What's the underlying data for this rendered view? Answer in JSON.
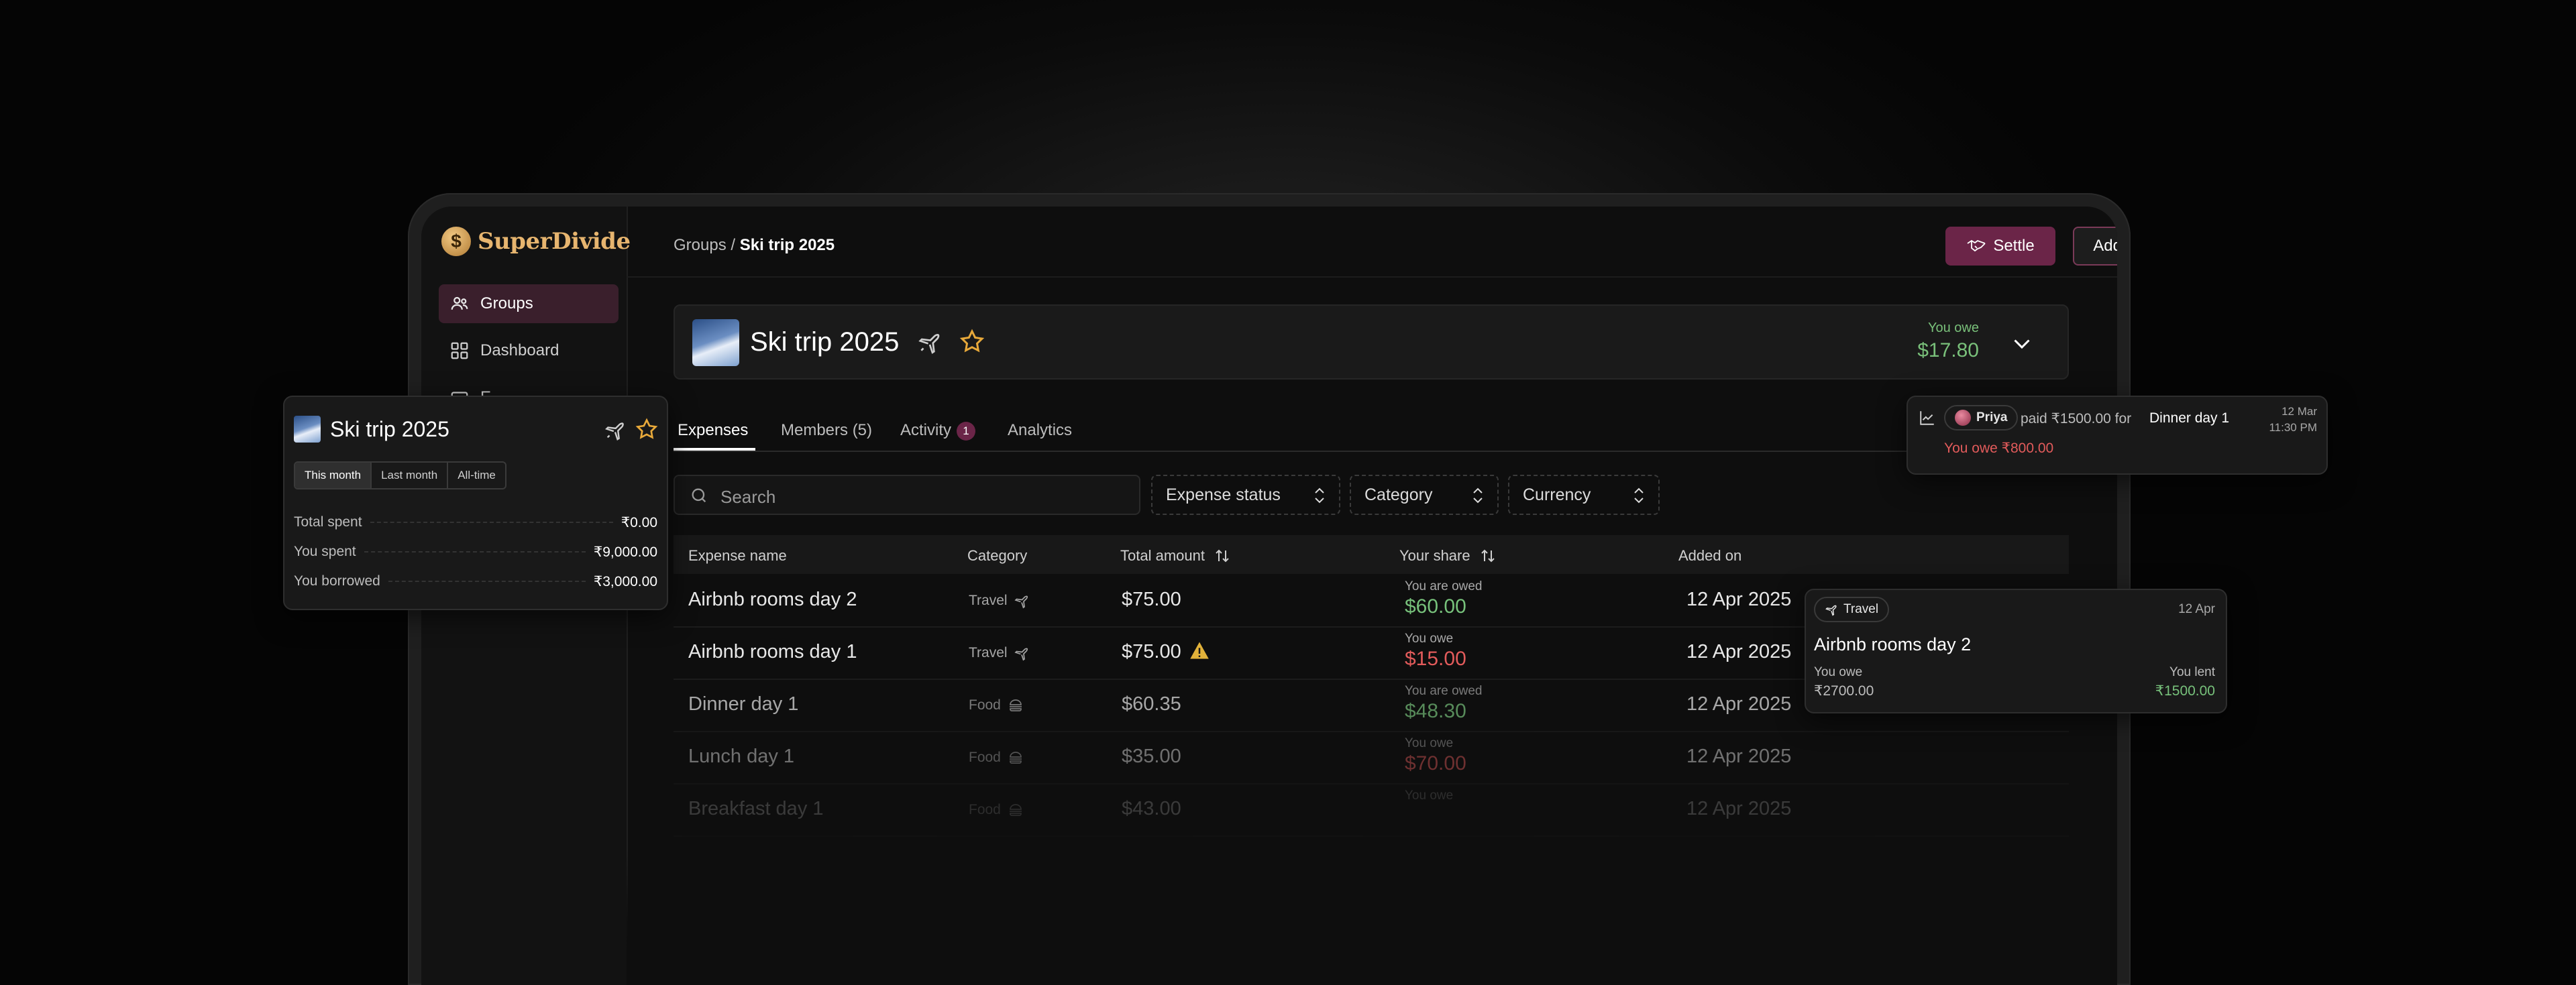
{
  "app": {
    "brand": "SuperDivide",
    "sidebar": [
      {
        "label": "Groups",
        "icon": "users-icon",
        "active": true
      },
      {
        "label": "Dashboard",
        "icon": "dashboard-icon",
        "active": false
      },
      {
        "label": "E",
        "icon": "wallet-icon",
        "active": false
      }
    ]
  },
  "header": {
    "breadcrumb_root": "Groups",
    "breadcrumb_sep": "/",
    "breadcrumb_current": "Ski trip 2025",
    "settle_label": "Settle",
    "add_expense_label": "Add an expense"
  },
  "group": {
    "name": "Ski trip 2025",
    "owe_label": "You owe",
    "owe_amount": "$17.80"
  },
  "tabs": [
    {
      "label": "Expenses",
      "active": true
    },
    {
      "label": "Members (5)",
      "active": false
    },
    {
      "label": "Activity",
      "badge": "1",
      "active": false
    },
    {
      "label": "Analytics",
      "active": false
    }
  ],
  "filters": {
    "search_placeholder": "Search",
    "status": "Expense status",
    "category": "Category",
    "currency": "Currency"
  },
  "table": {
    "headers": [
      "Expense name",
      "Category",
      "Total amount",
      "Your share",
      "Added on"
    ],
    "rows": [
      {
        "name": "Airbnb rooms day 2",
        "category": "Travel",
        "cat_icon": "plane-icon",
        "total": "$75.00",
        "warn": false,
        "share_label": "You are owed",
        "share": "$60.00",
        "share_type": "pos",
        "date": "12 Apr 2025"
      },
      {
        "name": "Airbnb rooms day 1",
        "category": "Travel",
        "cat_icon": "plane-icon",
        "total": "$75.00",
        "warn": true,
        "share_label": "You owe",
        "share": "$15.00",
        "share_type": "neg",
        "date": "12 Apr 2025"
      },
      {
        "name": "Dinner day 1",
        "category": "Food",
        "cat_icon": "burger-icon",
        "total": "$60.35",
        "warn": false,
        "share_label": "You are owed",
        "share": "$48.30",
        "share_type": "pos",
        "date": "12 Apr 2025"
      },
      {
        "name": "Lunch day 1",
        "category": "Food",
        "cat_icon": "burger-icon",
        "total": "$35.00",
        "warn": false,
        "share_label": "You owe",
        "share": "$70.00",
        "share_type": "neg",
        "date": "12 Apr 2025"
      },
      {
        "name": "Breakfast day 1",
        "category": "Food",
        "cat_icon": "burger-icon",
        "total": "$43.00",
        "warn": false,
        "share_label": "You owe",
        "share": "",
        "share_type": "neg",
        "date": "12 Apr 2025"
      }
    ]
  },
  "summary_card": {
    "title": "Ski trip 2025",
    "periods": [
      "This month",
      "Last month",
      "All-time"
    ],
    "rows": [
      {
        "label": "Total spent",
        "value": "₹0.00"
      },
      {
        "label": "You spent",
        "value": "₹9,000.00"
      },
      {
        "label": "You borrowed",
        "value": "₹3,000.00"
      }
    ]
  },
  "activity_card": {
    "user": "Priya",
    "text_paid": "paid ₹1500.00 for",
    "item": "Dinner day 1",
    "date": "12 Mar",
    "time": "11:30 PM",
    "owe_text": "You owe ₹800.00"
  },
  "expense_card": {
    "category": "Travel",
    "date": "12 Apr",
    "title": "Airbnb rooms day 2",
    "left_label": "You owe",
    "left_value": "₹2700.00",
    "right_label": "You lent",
    "right_value": "₹1500.00"
  },
  "colors": {
    "accent": "#6b2548",
    "positive": "#77c17b",
    "negative": "#e25b5b",
    "gold": "#e7b56f"
  }
}
